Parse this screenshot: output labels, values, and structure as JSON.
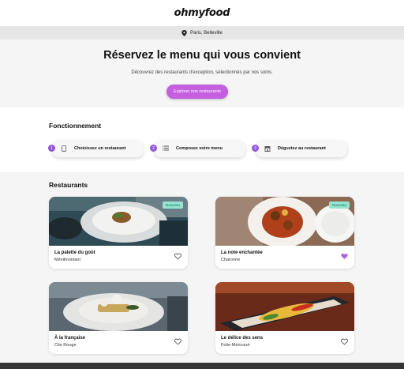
{
  "header": {
    "logo": "ohmyfood"
  },
  "location": {
    "text": "Paris, Belleville"
  },
  "hero": {
    "title": "Réservez le menu qui vous convient",
    "subtitle": "Découvrez des restaurants d'exception, sélectionnés par nos soins.",
    "cta": "Explorer nos restaurants"
  },
  "howto": {
    "title": "Fonctionnement",
    "steps": [
      {
        "num": "1",
        "label": "Choisissez un restaurant",
        "icon": "mobile-icon"
      },
      {
        "num": "2",
        "label": "Composez votre menu",
        "icon": "list-icon"
      },
      {
        "num": "3",
        "label": "Dégustez au restaurant",
        "icon": "store-icon"
      }
    ]
  },
  "restaurants": {
    "title": "Restaurants",
    "items": [
      {
        "name": "La palette du goût",
        "area": "Ménilmontant",
        "badge": "Nouveau",
        "liked": false
      },
      {
        "name": "La note enchantée",
        "area": "Charonne",
        "badge": "Nouveau",
        "liked": true
      },
      {
        "name": "À la française",
        "area": "Cite Rouge",
        "badge": "",
        "liked": false
      },
      {
        "name": "Le délice des sens",
        "area": "Folie-Méricourt",
        "badge": "",
        "liked": false
      }
    ]
  },
  "colors": {
    "accent": "#9356dc",
    "cta": "#c45fe0",
    "badge": "#99e2d0",
    "footer": "#333333"
  }
}
